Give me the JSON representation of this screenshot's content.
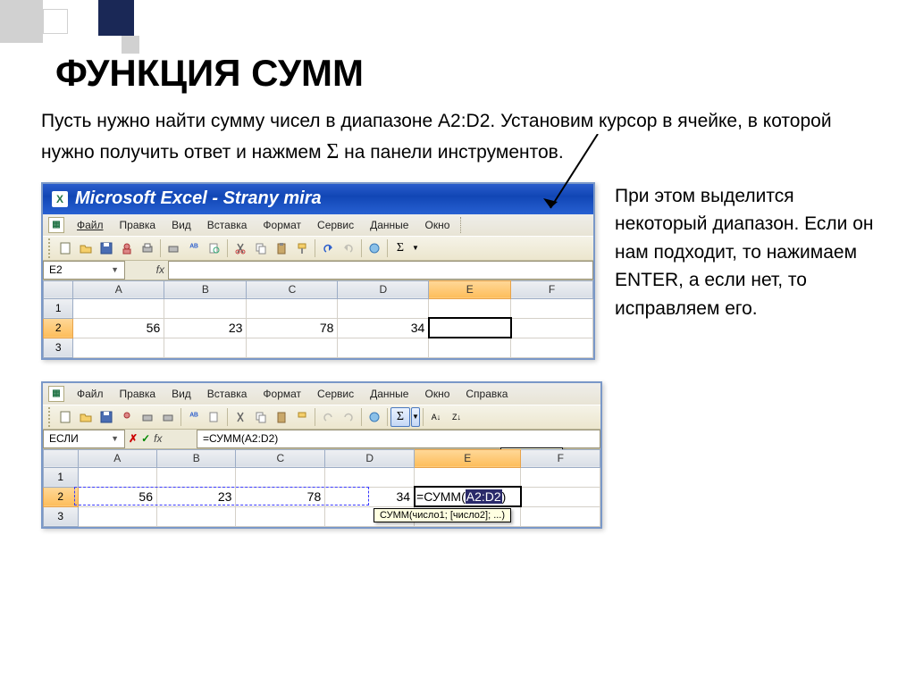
{
  "slide": {
    "title": "ФУНКЦИЯ СУММ",
    "intro_a": "Пусть нужно найти сумму чисел в диапазоне A2:D2. Установим курсор в ячейке, в которой нужно получить ответ и нажмем ",
    "intro_sigma": "Σ",
    "intro_b": " на панели инструментов.",
    "side_text": "При этом выделится некоторый диапазон. Если он нам подходит, то нажимаем ENTER, а если нет, то исправляем его."
  },
  "excel": {
    "winTitle": "Microsoft Excel - Strany mira",
    "menus": [
      "Файл",
      "Правка",
      "Вид",
      "Вставка",
      "Формат",
      "Сервис",
      "Данные",
      "Окно",
      "Справка"
    ],
    "menuUnderlineIdx": [
      0,
      0,
      0,
      2,
      1,
      0,
      -1,
      1,
      2
    ],
    "nameBox1": "E2",
    "nameBox2": "ЕСЛИ",
    "fbar2": "=СУММ(A2:D2)",
    "cols": [
      "A",
      "B",
      "C",
      "D",
      "E",
      "F"
    ],
    "rows": [
      "1",
      "2",
      "3"
    ],
    "rowData": [
      "56",
      "23",
      "78",
      "34"
    ],
    "sumExprPrefix": "=СУММ(",
    "sumExprArg": "A2:D2",
    "sumExprSuffix": ")",
    "sigTooltip": "СУММ(число1; [число2]; ...)",
    "autosumLabel": "Автосумма"
  }
}
